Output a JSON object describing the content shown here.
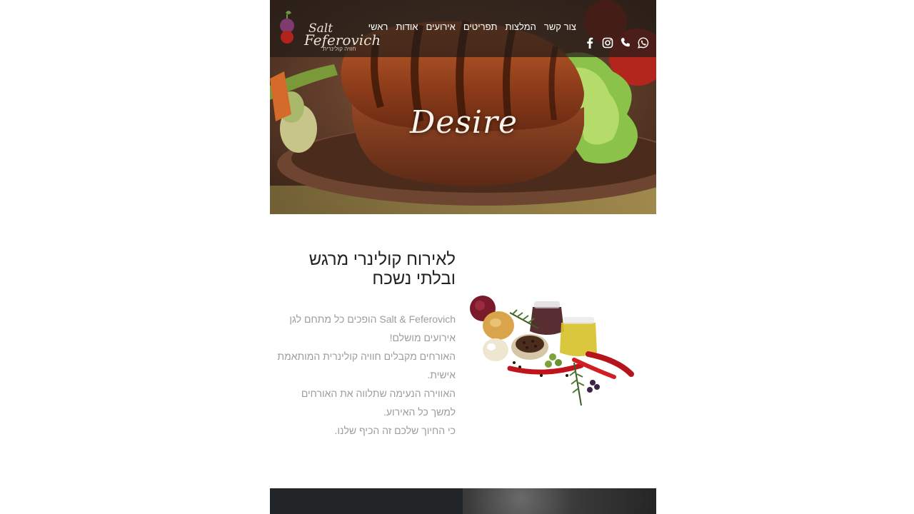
{
  "brand": {
    "name_line1": "Salt",
    "name_line2": "Feferovich",
    "tagline": "חוויה קולינרית"
  },
  "nav": {
    "items": [
      {
        "label": "ראשי"
      },
      {
        "label": "אודות"
      },
      {
        "label": "אירועים"
      },
      {
        "label": "תפריטים"
      },
      {
        "label": "המלצות"
      },
      {
        "label": "צור קשר"
      }
    ]
  },
  "socials": {
    "icons": [
      "whatsapp-icon",
      "phone-icon",
      "instagram-icon",
      "facebook-icon"
    ]
  },
  "hero": {
    "title": "Desire"
  },
  "intro": {
    "heading": "לאירוח קולינרי מרגש ובלתי נשכח",
    "paragraphs": [
      "Salt & Feferovich הופכים כל מתחם לגן אירועים מושלם!",
      "האורחים מקבלים חוויה קולינרית המותאמת אישית.",
      "האווירה הנעימה שתלווה את האורחים למשך כל האירוע.",
      "כי החיוך שלכם זה הכיף שלנו."
    ]
  },
  "colors": {
    "header_overlay": "#231c18",
    "heading_text": "#222222",
    "body_text": "#9c9c9c",
    "footer_dark": "#222527"
  }
}
